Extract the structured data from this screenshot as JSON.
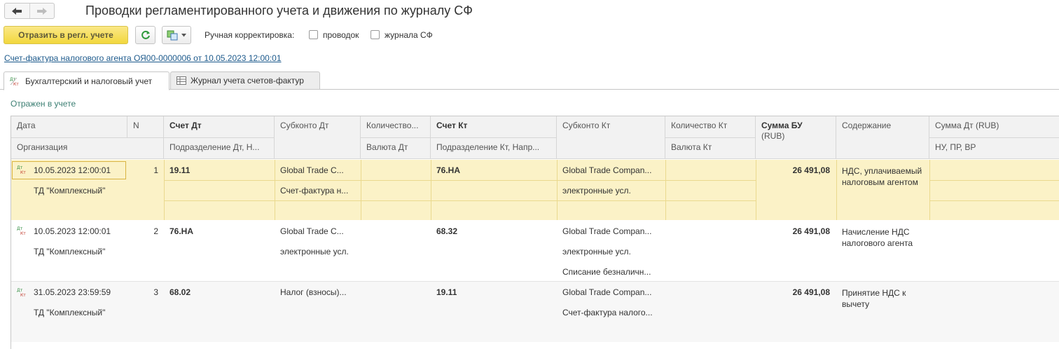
{
  "window": {
    "title": "Проводки регламентированного учета и движения по журналу СФ"
  },
  "toolbar": {
    "reflect_label": "Отразить в регл. учете",
    "manual_correction_label": "Ручная корректировка:",
    "checkbox_entries_label": "проводок",
    "checkbox_journal_label": "журнала СФ"
  },
  "document_link": "Счет-фактура налогового агента ОЯ00-0000006 от 10.05.2023 12:00:01",
  "tabs": [
    {
      "label": "Бухгалтерский и налоговый учет"
    },
    {
      "label": "Журнал учета счетов-фактур"
    }
  ],
  "status_text": "Отражен в учете",
  "grid": {
    "headers": {
      "date": "Дата",
      "org": "Организация",
      "n": "N",
      "acc_dt": "Счет Дт",
      "dept_dt": "Подразделение Дт, Н...",
      "sub_dt": "Субконто Дт",
      "qty_dt": "Количество...",
      "cur_dt": "Валюта Дт",
      "acc_kt": "Счет Кт",
      "dept_kt": "Подразделение Кт, Напр...",
      "sub_kt": "Субконто Кт",
      "qty_kt": "Количество Кт",
      "cur_kt": "Валюта Кт",
      "sum_bu": "Сумма БУ",
      "sum_bu_cur": "(RUB)",
      "content": "Содержание",
      "sum_dt": "Сумма Дт (RUB)",
      "nu_pr_vr": "НУ, ПР, ВР"
    },
    "rows": [
      {
        "date": "10.05.2023 12:00:01",
        "org": "ТД \"Комплексный\"",
        "n": "1",
        "acc_dt": "19.11",
        "sub_dt_1": "Global Trade C...",
        "sub_dt_2": "Счет-фактура н...",
        "acc_kt": "76.НА",
        "sub_kt_1": "Global Trade Compan...",
        "sub_kt_2": "электронные усл.",
        "sum": "26 491,08",
        "content": "НДС, уплачиваемый налоговым агентом"
      },
      {
        "date": "10.05.2023 12:00:01",
        "org": "ТД \"Комплексный\"",
        "n": "2",
        "acc_dt": "76.НА",
        "sub_dt_1": "Global Trade C...",
        "sub_dt_2": "электронные усл.",
        "acc_kt": "68.32",
        "sub_kt_1": "Global Trade Compan...",
        "sub_kt_2": "электронные усл.",
        "sub_kt_3": "Списание безналичн...",
        "sum": "26 491,08",
        "content": "Начисление НДС налогового агента"
      },
      {
        "date": "31.05.2023 23:59:59",
        "org": "ТД \"Комплексный\"",
        "n": "3",
        "acc_dt": "68.02",
        "sub_dt_1": "Налог (взносы)...",
        "acc_kt": "19.11",
        "sub_kt_1": "Global Trade Compan...",
        "sub_kt_2": "Счет-фактура налого...",
        "sum": "26 491,08",
        "content": "Принятие НДС к вычету"
      }
    ],
    "row_icon": {
      "top": "Дт",
      "bottom": "Кт"
    }
  },
  "colors": {
    "accent_yellow": "#f2d73d",
    "selected_row": "#fbf2c7",
    "link_blue": "#1d5a8c",
    "status_green": "#3c7f73"
  }
}
